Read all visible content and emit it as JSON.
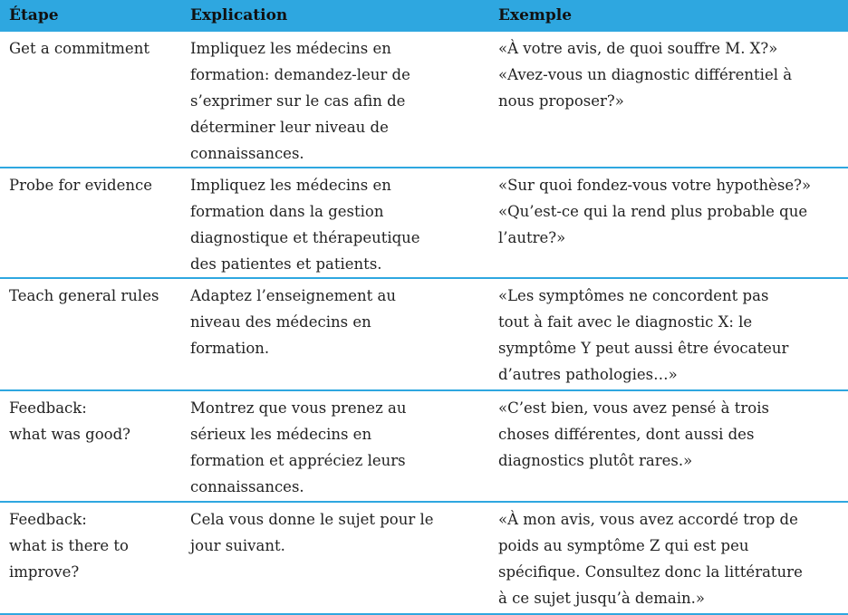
{
  "headers": [
    "Étape",
    "Explication",
    "Exemple"
  ],
  "rows": [
    {
      "step": [
        "Get a commitment"
      ],
      "explanation": [
        "Impliquez les médecins en",
        "formation: demandez-leur de",
        "s’exprimer sur le cas afin de",
        "déterminer leur niveau de",
        "connaissances."
      ],
      "example": [
        "«À votre avis, de quoi souffre M. X?»",
        "«Avez-vous un diagnostic différentiel à",
        "nous proposer?»"
      ]
    },
    {
      "step": [
        "Probe for evidence"
      ],
      "explanation": [
        "Impliquez les médecins en",
        "formation dans la gestion",
        "diagnostique et thérapeutique",
        "des patientes et patients."
      ],
      "example": [
        "«Sur quoi fondez-vous votre hypothèse?»",
        "«Qu’est-ce qui la rend plus probable que",
        "l’autre?»"
      ]
    },
    {
      "step": [
        "Teach general rules"
      ],
      "explanation": [
        "Adaptez l’enseignement au",
        "niveau des médecins en",
        "formation."
      ],
      "example": [
        "«Les symptômes ne concordent pas",
        "tout à fait avec le diagnostic X: le",
        "symptôme Y peut aussi être évocateur",
        "d’autres pathologies…»"
      ]
    },
    {
      "step": [
        "Feedback:",
        "what was good?"
      ],
      "explanation": [
        "Montrez que vous prenez au",
        "sérieux les médecins en",
        "formation et appréciez leurs",
        "connaissances."
      ],
      "example": [
        "«C’est bien, vous avez pensé à trois",
        "choses différentes, dont aussi des",
        "diagnostics plutôt rares.»"
      ]
    },
    {
      "step": [
        "Feedback:",
        "what is there to",
        "improve?"
      ],
      "explanation": [
        "Cela vous donne le sujet pour le",
        "jour suivant."
      ],
      "example": [
        "«À mon avis, vous avez accordé trop de",
        "poids au symptôme Z qui est peu",
        "spécifique. Consultez donc la littérature",
        "à ce sujet jusqu’à demain.»"
      ]
    }
  ],
  "colors": {
    "header_bg": "#2ea7e0",
    "rule": "#2ea7e0"
  }
}
